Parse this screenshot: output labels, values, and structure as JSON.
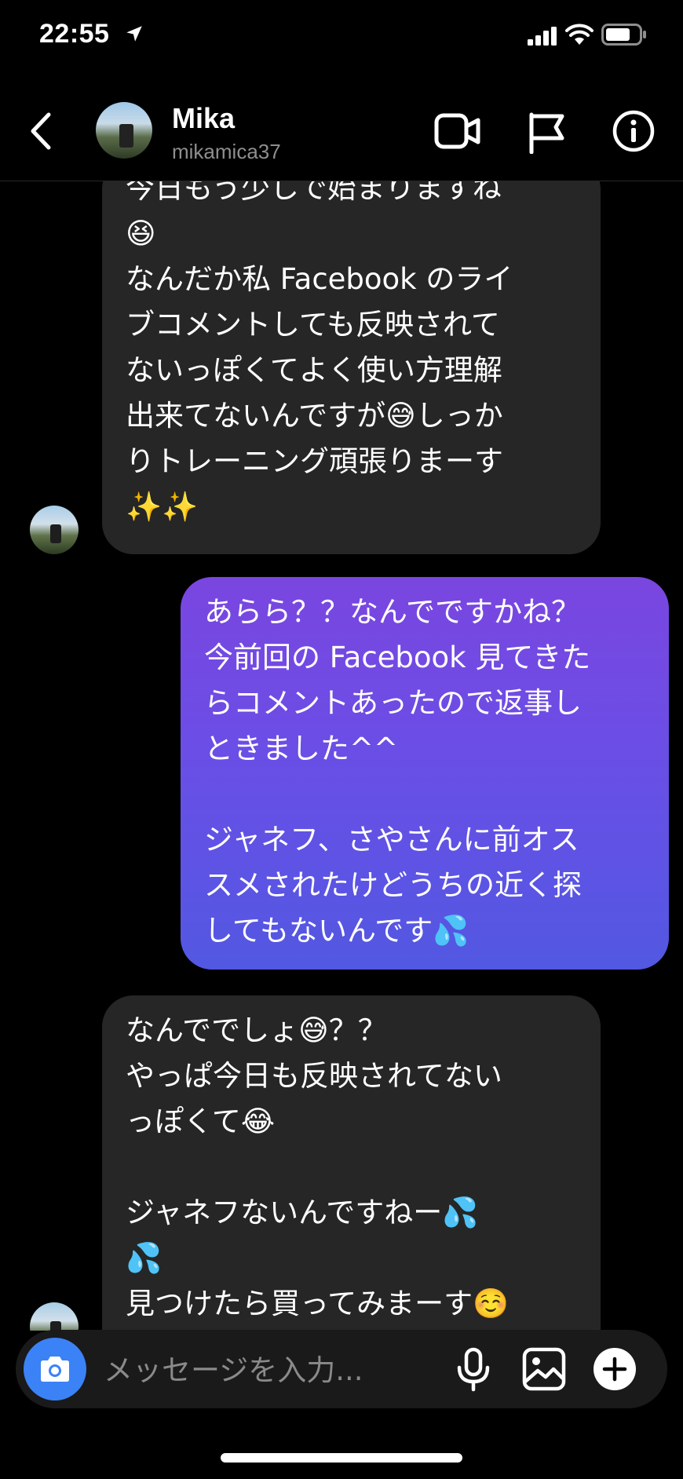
{
  "status_bar": {
    "time": "22:55"
  },
  "header": {
    "name": "Mika",
    "handle": "mikamica37"
  },
  "messages": [
    {
      "direction": "incoming",
      "text": "今日もう少しで始まりますね\n😆\nなんだか私 Facebook のライ\nブコメントしても反映されて\nないっぽくてよく使い方理解\n出来てないんですが😅しっか\nりトレーニング頑張りまーす\n✨✨"
    },
    {
      "direction": "outgoing",
      "text": "あらら？？なんでですかね？\n今前回の Facebook 見てきた\nらコメントあったので返事し\nときました^^\n\nジャネフ、さやさんに前オス\nスメされたけどうちの近く探\nしてもないんです💦"
    },
    {
      "direction": "incoming",
      "text": "なんででしょ😅？？\nやっぱ今日も反映されてない\nっぽくて😂\n\nジャネフないんですねー💦\n💦\n見つけたら買ってみまーす☺️"
    }
  ],
  "composer": {
    "placeholder": "メッセージを入力..."
  },
  "icons": {
    "back": "back-chevron-icon",
    "video": "video-call-icon",
    "flag": "flag-icon",
    "info": "info-icon",
    "camera": "camera-icon",
    "mic": "microphone-icon",
    "gallery": "gallery-icon",
    "plus": "plus-icon"
  },
  "colors": {
    "camera_button": "#3b82f6",
    "incoming_bubble": "#262626",
    "outgoing_gradient_top": "#7a46e0",
    "outgoing_gradient_bottom": "#5258e2"
  }
}
